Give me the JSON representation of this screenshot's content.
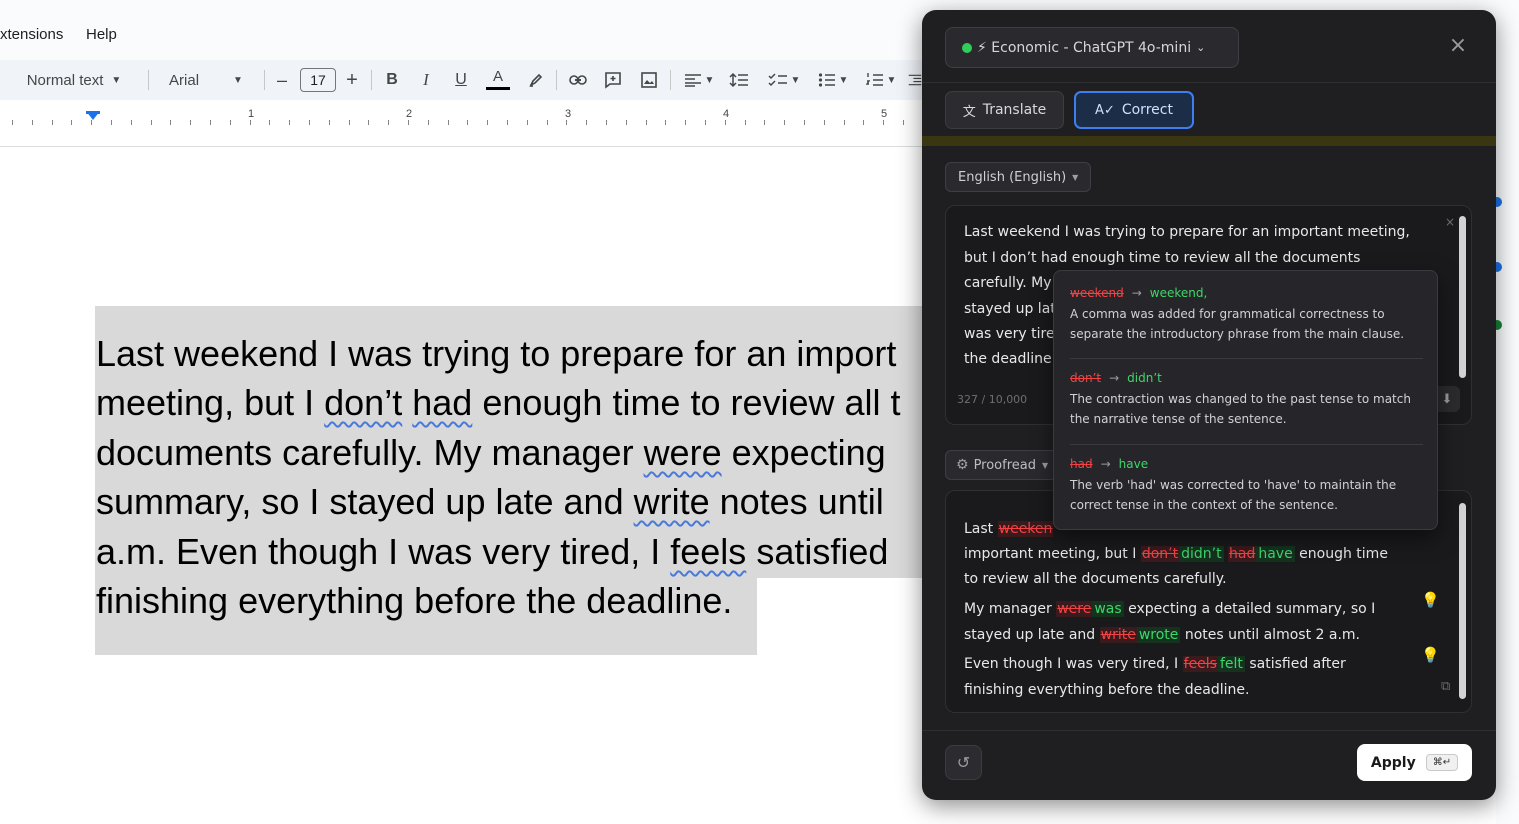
{
  "docs": {
    "menu": [
      "xtensions",
      "Help"
    ],
    "toolbar": {
      "style": "Normal text",
      "font": "Arial",
      "font_size": "17",
      "minus": "–",
      "plus": "+",
      "bold": "B",
      "italic": "I",
      "underline": "U",
      "text_color": "A"
    },
    "ruler_numbers": [
      "1",
      "2",
      "3",
      "4",
      "5"
    ],
    "lines": [
      [
        "Last weekend I was trying to prepare for an import"
      ],
      [
        "meeting, but I ",
        {
          "w": "don’t"
        },
        " ",
        {
          "w": "had"
        },
        " enough time to review all t"
      ],
      [
        "documents carefully. My manager ",
        {
          "w": "were"
        },
        " expecting"
      ],
      [
        "summary, so I stayed up late and ",
        {
          "w": "write"
        },
        " notes until"
      ],
      [
        "a.m. Even though I was very tired, I ",
        {
          "w": "feels"
        },
        " satisfied"
      ],
      [
        "finishing everything before the deadline."
      ]
    ]
  },
  "panel": {
    "model_label": "⚡ Economic - ChatGPT 4o-mini",
    "model_chevron": "⌄",
    "close": "×",
    "translate_icon": "文",
    "translate_label": "Translate",
    "correct_icon": "A✓",
    "correct_label": "Correct",
    "language": "English (English)",
    "input_lines": [
      "Last weekend I was trying to prepare for an important meeting,",
      "but I don’t had enough time to review all the documents",
      "carefully. My",
      "stayed up lat",
      "was very tire",
      "the deadline."
    ],
    "counter": "327 / 10,000",
    "proofread_label": "Proofread",
    "output_lines": [
      [
        "Last ",
        {
          "del": "weeken"
        }
      ],
      [
        "important meeting, but I ",
        {
          "del": "don’t"
        },
        {
          "ins": "didn’t"
        },
        " ",
        {
          "del": "had"
        },
        {
          "ins": "have"
        },
        " enough time"
      ],
      [
        "to review all the documents carefully."
      ],
      [
        "My manager ",
        {
          "del": "were"
        },
        {
          "ins": "was"
        },
        " expecting a detailed summary, so I"
      ],
      [
        "stayed up late and ",
        {
          "del": "write"
        },
        {
          "ins": "wrote"
        },
        " notes until almost 2 a.m."
      ],
      [
        "Even though I was very tired, I ",
        {
          "del": "feels"
        },
        {
          "ins": "felt"
        },
        " satisfied after"
      ],
      [
        "finishing everything before the deadline."
      ]
    ],
    "apply_label": "Apply",
    "apply_shortcut": "⌘↵"
  },
  "popover": {
    "suggestions": [
      {
        "old": "weekend",
        "new": "weekend,",
        "desc": "A comma was added for grammatical correctness to separate the introductory phrase from the main clause."
      },
      {
        "old": "don’t",
        "new": "didn’t",
        "desc": "The contraction was changed to the past tense to match the narrative tense of the sentence."
      },
      {
        "old": "had",
        "new": "have",
        "desc": "The verb 'had' was corrected to 'have' to maintain the correct tense in the context of the sentence."
      }
    ]
  },
  "colors": {
    "accent": "#3d7ff2",
    "deleted": "#f04444",
    "inserted": "#3ed66a",
    "status_online": "#2fce5b"
  }
}
